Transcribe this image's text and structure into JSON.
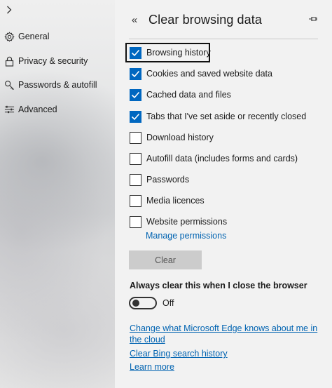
{
  "sidebar": {
    "items": [
      {
        "label": "General",
        "icon": "gear-icon"
      },
      {
        "label": "Privacy & security",
        "icon": "lock-icon"
      },
      {
        "label": "Passwords & autofill",
        "icon": "key-icon"
      },
      {
        "label": "Advanced",
        "icon": "sliders-icon"
      }
    ]
  },
  "panel": {
    "title": "Clear browsing data",
    "back_icon": "«",
    "options": [
      {
        "label": "Browsing history",
        "checked": true
      },
      {
        "label": "Cookies and saved website data",
        "checked": true
      },
      {
        "label": "Cached data and files",
        "checked": true
      },
      {
        "label": "Tabs that I've set aside or recently closed",
        "checked": true
      },
      {
        "label": "Download history",
        "checked": false
      },
      {
        "label": "Autofill data (includes forms and cards)",
        "checked": false
      },
      {
        "label": "Passwords",
        "checked": false
      },
      {
        "label": "Media licences",
        "checked": false
      },
      {
        "label": "Website permissions",
        "checked": false
      }
    ],
    "manage_permissions_link": "Manage permissions",
    "clear_button": "Clear",
    "always_clear_label": "Always clear this when I close the browser",
    "toggle_state": "Off",
    "links": {
      "change_knows_line1": "Change what Microsoft Edge knows about me in",
      "change_knows_line2": "the cloud",
      "clear_bing": "Clear Bing search history",
      "learn_more": "Learn more"
    }
  },
  "colors": {
    "accent": "#0067c0",
    "link": "#0063b1",
    "button_disabled": "#cccccc",
    "panel_bg": "#f2f2f2"
  }
}
